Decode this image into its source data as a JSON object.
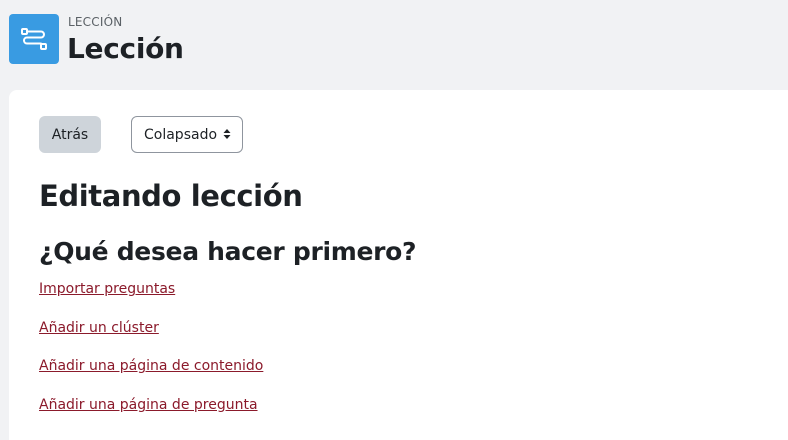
{
  "header": {
    "kicker": "LECCIÓN",
    "title": "Lección",
    "icon": "lesson-icon"
  },
  "toolbar": {
    "back_label": "Atrás",
    "view_select": {
      "selected": "Colapsado"
    }
  },
  "main": {
    "heading": "Editando lección",
    "subheading": "¿Qué desea hacer primero?",
    "links": [
      "Importar preguntas",
      "Añadir un clúster",
      "Añadir una página de contenido",
      "Añadir una página de pregunta"
    ]
  },
  "colors": {
    "accent_icon": "#399be2",
    "link": "#8b1a2b",
    "background": "#f1f2f4",
    "panel": "#ffffff"
  }
}
